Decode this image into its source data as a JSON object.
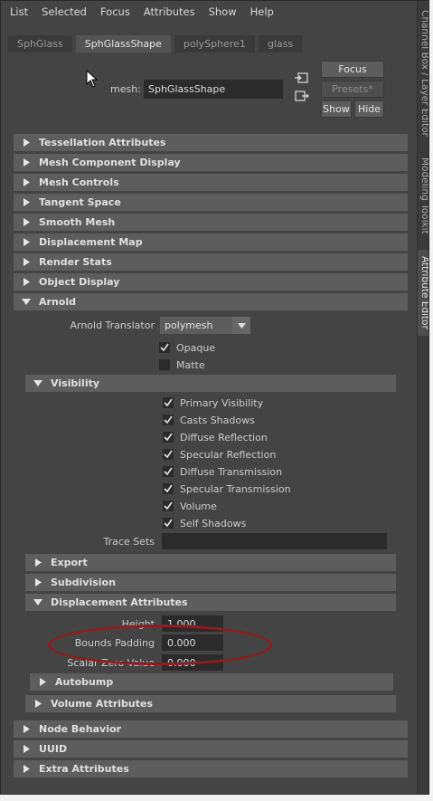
{
  "menu": [
    "List",
    "Selected",
    "Focus",
    "Attributes",
    "Show",
    "Help"
  ],
  "side_tabs": [
    "Channel Box / Layer Editor",
    "Modeling Toolkit",
    "Attribute Editor"
  ],
  "tabs": [
    {
      "label": "SphGlass",
      "active": false
    },
    {
      "label": "SphGlassShape",
      "active": true
    },
    {
      "label": "polySphere1",
      "active": false
    },
    {
      "label": "glass",
      "active": false
    }
  ],
  "mesh": {
    "label": "mesh:",
    "value": "SphGlassShape"
  },
  "buttons": {
    "focus": "Focus",
    "presets": "Presets*",
    "show": "Show",
    "hide": "Hide"
  },
  "sections_top": [
    "Tessellation Attributes",
    "Mesh Component Display",
    "Mesh Controls",
    "Tangent Space",
    "Smooth Mesh",
    "Displacement Map",
    "Render Stats",
    "Object Display"
  ],
  "arnold": {
    "label": "Arnold",
    "translator_label": "Arnold Translator",
    "translator_value": "polymesh",
    "opaque": {
      "label": "Opaque",
      "checked": true
    },
    "matte": {
      "label": "Matte",
      "checked": false
    },
    "visibility": {
      "label": "Visibility",
      "items": [
        {
          "label": "Primary Visibility",
          "checked": true
        },
        {
          "label": "Casts Shadows",
          "checked": true
        },
        {
          "label": "Diffuse Reflection",
          "checked": true
        },
        {
          "label": "Specular Reflection",
          "checked": true
        },
        {
          "label": "Diffuse Transmission",
          "checked": true
        },
        {
          "label": "Specular Transmission",
          "checked": true
        },
        {
          "label": "Volume",
          "checked": true
        },
        {
          "label": "Self Shadows",
          "checked": true
        }
      ],
      "trace_sets_label": "Trace Sets",
      "trace_sets_value": ""
    },
    "export_label": "Export",
    "subdivision_label": "Subdivision",
    "displacement": {
      "label": "Displacement Attributes",
      "height": {
        "label": "Height",
        "value": "1.000"
      },
      "bounds_padding": {
        "label": "Bounds Padding",
        "value": "0.000"
      },
      "scalar_zero": {
        "label": "Scalar Zero Value",
        "value": "0.000"
      },
      "autobump_label": "Autobump"
    },
    "volume_attributes_label": "Volume Attributes"
  },
  "sections_bottom": [
    "Node Behavior",
    "UUID",
    "Extra Attributes"
  ],
  "colors": {
    "panel": "#444444",
    "header": "#5d5d5d",
    "field": "#2b2b2b",
    "annotation": "#8f1d1d"
  }
}
